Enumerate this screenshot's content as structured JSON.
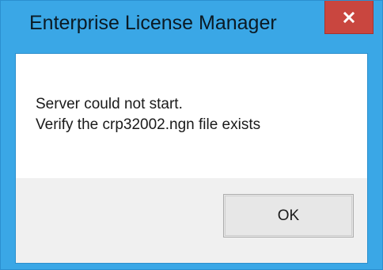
{
  "window": {
    "title": "Enterprise License Manager",
    "close_icon": "close-x-icon"
  },
  "message": {
    "line1": "Server could not start.",
    "line2": "Verify the crp32002.ngn file exists"
  },
  "buttons": {
    "ok_label": "OK"
  },
  "colors": {
    "frame": "#3aa7e6",
    "close_button": "#c9463f",
    "client": "#ffffff",
    "footer": "#f0f0f0"
  }
}
